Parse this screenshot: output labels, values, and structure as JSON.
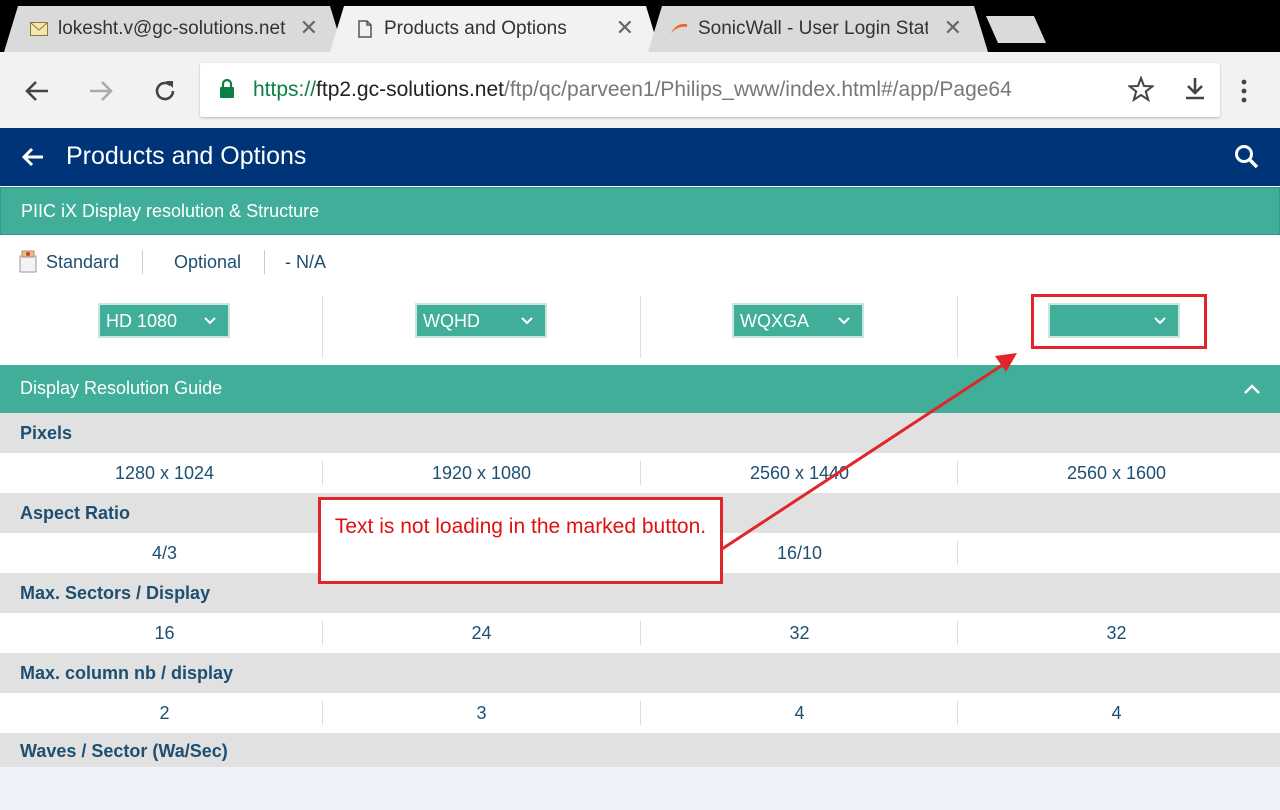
{
  "browser": {
    "tabs": [
      {
        "title": "lokesht.v@gc-solutions.net",
        "icon": "mail-icon"
      },
      {
        "title": "Products and Options",
        "icon": "page-icon"
      },
      {
        "title": "SonicWall - User Login Status",
        "icon": "sonicwall-icon"
      }
    ],
    "url": {
      "scheme": "https://",
      "host": "ftp2.gc-solutions.net",
      "path": "/ftp/qc/parveen1/Philips_www/index.html#/app/Page64"
    }
  },
  "app": {
    "title": "Products and Options",
    "section_title": "PIIC iX Display resolution & Structure",
    "legend": {
      "standard": "Standard",
      "optional": "Optional",
      "na": "- N/A"
    },
    "selects": [
      "HD 1080",
      "WQHD",
      "WQXGA",
      ""
    ],
    "guide_title": "Display Resolution Guide",
    "rows": [
      {
        "label": "Pixels",
        "values": [
          "1280 x 1024",
          "1920 x 1080",
          "2560 x 1440",
          "2560 x 1600"
        ]
      },
      {
        "label": "Aspect Ratio",
        "values": [
          "4/3",
          "",
          "16/10",
          ""
        ]
      },
      {
        "label": "Max. Sectors / Display",
        "values": [
          "16",
          "24",
          "32",
          "32"
        ]
      },
      {
        "label": "Max. column nb / display",
        "values": [
          "2",
          "3",
          "4",
          "4"
        ]
      },
      {
        "label": "Waves / Sector (Wa/Sec)",
        "values": []
      }
    ]
  },
  "annotation": {
    "text": "Text is not loading in the marked button."
  },
  "colors": {
    "header_blue": "#003478",
    "teal": "#40ae98",
    "text_blue": "#1d4f72",
    "annotation_red": "#e0262b"
  }
}
